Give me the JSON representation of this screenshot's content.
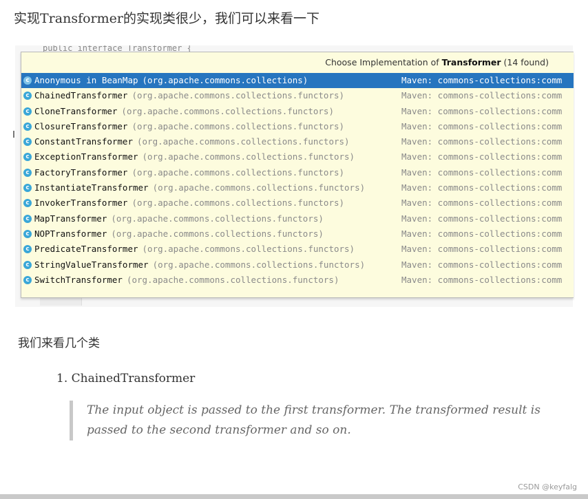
{
  "intro_text": "实现Transformer的实现类很少，我们可以来看一下",
  "ide_code_peek": "public interface Transformer {",
  "popup": {
    "header_prefix": "Choose Implementation of ",
    "header_bold": "Transformer",
    "header_suffix": " (14 found)",
    "items": [
      {
        "name": "Anonymous in BeanMap",
        "package": "(org.apache.commons.collections)",
        "source": "Maven: commons-collections:comm",
        "selected": true
      },
      {
        "name": "ChainedTransformer",
        "package": "(org.apache.commons.collections.functors)",
        "source": "Maven: commons-collections:comm"
      },
      {
        "name": "CloneTransformer",
        "package": "(org.apache.commons.collections.functors)",
        "source": "Maven: commons-collections:comm"
      },
      {
        "name": "ClosureTransformer",
        "package": "(org.apache.commons.collections.functors)",
        "source": "Maven: commons-collections:comm"
      },
      {
        "name": "ConstantTransformer",
        "package": "(org.apache.commons.collections.functors)",
        "source": "Maven: commons-collections:comm"
      },
      {
        "name": "ExceptionTransformer",
        "package": "(org.apache.commons.collections.functors)",
        "source": "Maven: commons-collections:comm"
      },
      {
        "name": "FactoryTransformer",
        "package": "(org.apache.commons.collections.functors)",
        "source": "Maven: commons-collections:comm"
      },
      {
        "name": "InstantiateTransformer",
        "package": "(org.apache.commons.collections.functors)",
        "source": "Maven: commons-collections:comm"
      },
      {
        "name": "InvokerTransformer",
        "package": "(org.apache.commons.collections.functors)",
        "source": "Maven: commons-collections:comm"
      },
      {
        "name": "MapTransformer",
        "package": "(org.apache.commons.collections.functors)",
        "source": "Maven: commons-collections:comm"
      },
      {
        "name": "NOPTransformer",
        "package": "(org.apache.commons.collections.functors)",
        "source": "Maven: commons-collections:comm"
      },
      {
        "name": "PredicateTransformer",
        "package": "(org.apache.commons.collections.functors)",
        "source": "Maven: commons-collections:comm"
      },
      {
        "name": "StringValueTransformer",
        "package": "(org.apache.commons.collections.functors)",
        "source": "Maven: commons-collections:comm"
      },
      {
        "name": "SwitchTransformer",
        "package": "(org.apache.commons.collections.functors)",
        "source": "Maven: commons-collections:comm"
      }
    ],
    "class_icon_glyph": "c"
  },
  "sub_text": "我们来看几个类",
  "list_item": "1. ChainedTransformer",
  "quote_text": "The input object is passed to the first transformer. The transformed result is passed to the second transformer and so on.",
  "watermark": "CSDN @keyfalg",
  "colors": {
    "popup_bg": "#fdfcde",
    "selected_bg": "#2675bf",
    "class_icon": "#3aa7d8"
  }
}
